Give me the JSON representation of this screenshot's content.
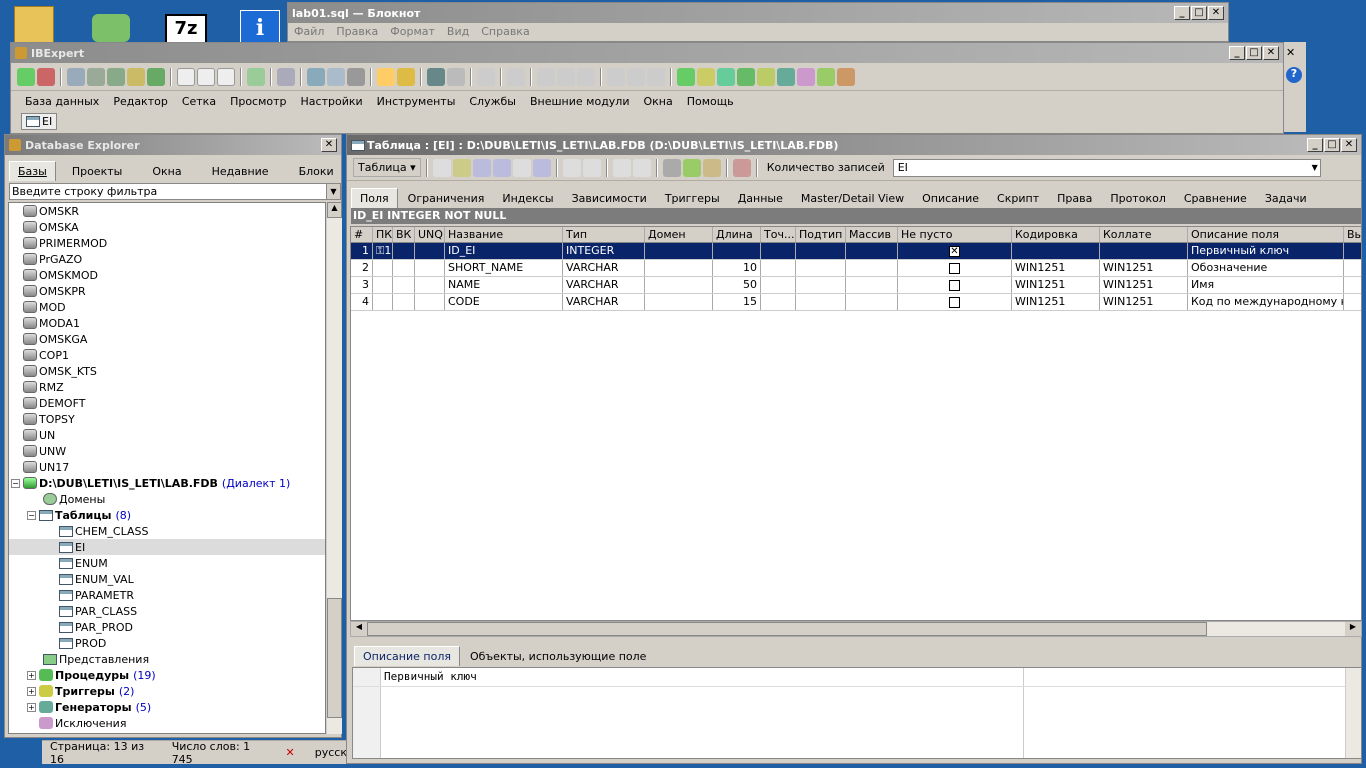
{
  "notepad": {
    "title": "lab01.sql — Блокнот",
    "menu": [
      "Файл",
      "Правка",
      "Формат",
      "Вид",
      "Справка"
    ]
  },
  "ibexpert": {
    "title": "IBExpert",
    "menu": [
      "База данных",
      "Редактор",
      "Сетка",
      "Просмотр",
      "Настройки",
      "Инструменты",
      "Службы",
      "Внешние модули",
      "Окна",
      "Помощь"
    ],
    "window_tab": "EI"
  },
  "explorer": {
    "title": "Database Explorer",
    "tabs": [
      "Базы",
      "Проекты",
      "Окна",
      "Недавние",
      "Блоки"
    ],
    "filter_placeholder": "Введите строку фильтра",
    "databases": [
      "OMSKR",
      "OMSKA",
      "PRIMERMOD",
      "PrGAZO",
      "OMSKMOD",
      "OMSKPR",
      "MOD",
      "MODA1",
      "OMSKGA",
      "COP1",
      "OMSK_KTS",
      "RMZ",
      "DEMOFT",
      "TOPSY",
      "UN",
      "UNW",
      "UN17"
    ],
    "active_db": "D:\\DUB\\LETI\\IS_LETI\\LAB.FDB",
    "active_db_dialect": "(Диалект 1)",
    "domains": "Домены",
    "tables_label": "Таблицы",
    "tables_count": "(8)",
    "tables": [
      "CHEM_CLASS",
      "EI",
      "ENUM",
      "ENUM_VAL",
      "PARAMETR",
      "PAR_CLASS",
      "PAR_PROD",
      "PROD"
    ],
    "views": "Представления",
    "procedures_label": "Процедуры",
    "procedures_count": "(19)",
    "triggers_label": "Триггеры",
    "triggers_count": "(2)",
    "generators_label": "Генераторы",
    "generators_count": "(5)",
    "exceptions": "Исключения"
  },
  "status": {
    "page": "Страница: 13 из 16",
    "words": "Число слов: 1 745",
    "lang": "русск"
  },
  "table_editor": {
    "title": "Таблица : [EI] : D:\\DUB\\LETI\\IS_LETI\\LAB.FDB (D:\\DUB\\LETI\\IS_LETI\\LAB.FDB)",
    "table_button": "Таблица",
    "records_label": "Количество записей",
    "table_name": "EI",
    "tabs": [
      "Поля",
      "Ограничения",
      "Индексы",
      "Зависимости",
      "Триггеры",
      "Данные",
      "Master/Detail View",
      "Описание",
      "Скрипт",
      "Права",
      "Протокол",
      "Сравнение",
      "Задачи"
    ],
    "field_info": "ID_EI INTEGER NOT NULL",
    "columns": [
      "#",
      "ПК",
      "ВК",
      "UNQ",
      "Название",
      "Тип",
      "Домен",
      "Длина",
      "Точ...",
      "Подтип",
      "Массив",
      "Не пусто",
      "Кодировка",
      "Коллате",
      "Описание поля",
      "Вы"
    ],
    "rows": [
      {
        "n": "1",
        "pk": "⚿1",
        "name": "ID_EI",
        "type": "INTEGER",
        "len": "",
        "notnull": "☒",
        "enc": "",
        "coll": "",
        "desc": "Первичный ключ"
      },
      {
        "n": "2",
        "pk": "",
        "name": "SHORT_NAME",
        "type": "VARCHAR",
        "len": "10",
        "notnull": "☐",
        "enc": "WIN1251",
        "coll": "WIN1251",
        "desc": "Обозначение"
      },
      {
        "n": "3",
        "pk": "",
        "name": "NAME",
        "type": "VARCHAR",
        "len": "50",
        "notnull": "☐",
        "enc": "WIN1251",
        "coll": "WIN1251",
        "desc": "Имя"
      },
      {
        "n": "4",
        "pk": "",
        "name": "CODE",
        "type": "VARCHAR",
        "len": "15",
        "notnull": "☐",
        "enc": "WIN1251",
        "coll": "WIN1251",
        "desc": "Код по международному кл..."
      }
    ],
    "bottom_tabs": [
      "Описание поля",
      "Объекты, использующие поле"
    ],
    "description_text": "Первичный ключ"
  }
}
